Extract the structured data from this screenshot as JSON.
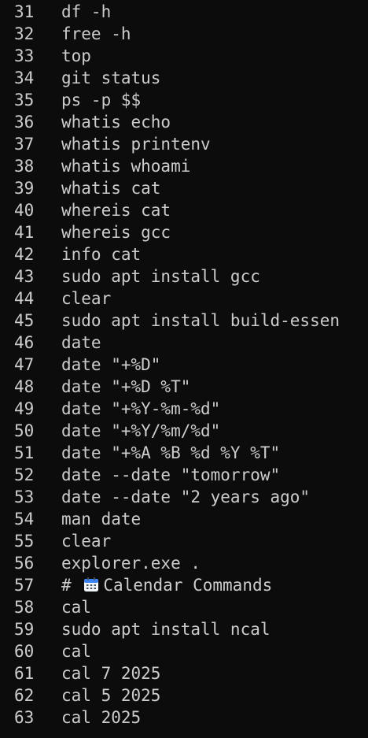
{
  "history": {
    "lines": [
      {
        "num": "31",
        "cmd": "df -h"
      },
      {
        "num": "32",
        "cmd": "free -h"
      },
      {
        "num": "33",
        "cmd": "top"
      },
      {
        "num": "34",
        "cmd": "git status"
      },
      {
        "num": "35",
        "cmd": "ps -p $$"
      },
      {
        "num": "36",
        "cmd": "whatis echo"
      },
      {
        "num": "37",
        "cmd": "whatis printenv"
      },
      {
        "num": "38",
        "cmd": "whatis whoami"
      },
      {
        "num": "39",
        "cmd": "whatis cat"
      },
      {
        "num": "40",
        "cmd": "whereis cat"
      },
      {
        "num": "41",
        "cmd": "whereis gcc"
      },
      {
        "num": "42",
        "cmd": "info cat"
      },
      {
        "num": "43",
        "cmd": "sudo apt install gcc"
      },
      {
        "num": "44",
        "cmd": "clear"
      },
      {
        "num": "45",
        "cmd": "sudo apt install build-essen"
      },
      {
        "num": "46",
        "cmd": "date"
      },
      {
        "num": "47",
        "cmd": "date \"+%D\""
      },
      {
        "num": "48",
        "cmd": "date \"+%D %T\""
      },
      {
        "num": "49",
        "cmd": "date \"+%Y-%m-%d\""
      },
      {
        "num": "50",
        "cmd": "date \"+%Y/%m/%d\""
      },
      {
        "num": "51",
        "cmd": "date \"+%A %B %d %Y %T\""
      },
      {
        "num": "52",
        "cmd": "date --date \"tomorrow\""
      },
      {
        "num": "53",
        "cmd": "date --date \"2 years ago\""
      },
      {
        "num": "54",
        "cmd": "man date"
      },
      {
        "num": "55",
        "cmd": "clear"
      },
      {
        "num": "56",
        "cmd": "explorer.exe ."
      },
      {
        "num": "57",
        "cmd_prefix": "#",
        "icon": "calendar-icon",
        "cmd_suffix": "Calendar Commands"
      },
      {
        "num": "58",
        "cmd": "cal"
      },
      {
        "num": "59",
        "cmd": "sudo apt install ncal"
      },
      {
        "num": "60",
        "cmd": "cal"
      },
      {
        "num": "61",
        "cmd": "cal 7 2025"
      },
      {
        "num": "62",
        "cmd": "cal 5 2025"
      },
      {
        "num": "63",
        "cmd": "cal 2025"
      }
    ]
  },
  "colors": {
    "background": "#0c0c0c",
    "foreground": "#cccccc"
  }
}
